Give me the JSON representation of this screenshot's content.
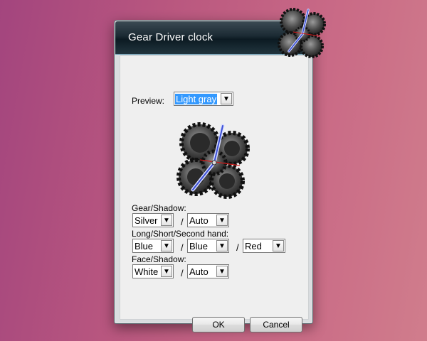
{
  "dialog": {
    "title": "Gear Driver clock"
  },
  "preview": {
    "label": "Preview:",
    "value": "Light gray"
  },
  "gear_shadow": {
    "label": "Gear/Shadow:",
    "gear": "Silver",
    "shadow": "Auto"
  },
  "hands": {
    "label": "Long/Short/Second hand:",
    "long": "Blue",
    "short": "Blue",
    "second": "Red"
  },
  "face_shadow": {
    "label": "Face/Shadow:",
    "face": "White",
    "shadow": "Auto"
  },
  "separator": "/",
  "buttons": {
    "ok": "OK",
    "cancel": "Cancel"
  },
  "icons": {
    "dropdown_arrow": "chevron-down-icon"
  },
  "colors": {
    "hand_long": "#3b4fd6",
    "hand_second": "#d01a1a",
    "gear": "#5e5e5e",
    "selection": "#3399ff"
  }
}
